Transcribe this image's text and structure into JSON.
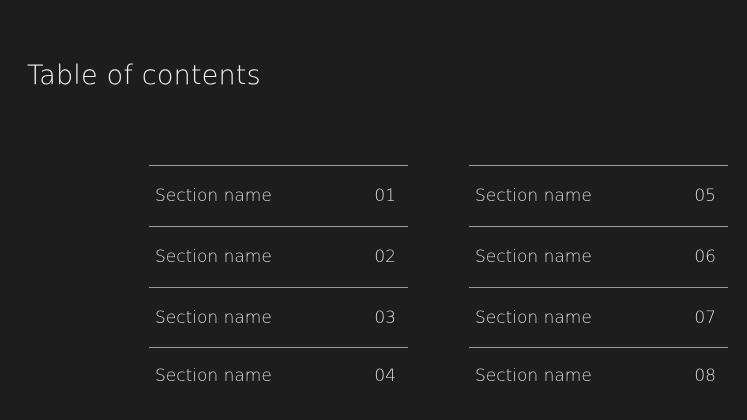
{
  "page": {
    "title": "Table of contents"
  },
  "toc": {
    "left": [
      {
        "label": "Section name",
        "number": "01"
      },
      {
        "label": "Section name",
        "number": "02"
      },
      {
        "label": "Section name",
        "number": "03"
      },
      {
        "label": "Section name",
        "number": "04"
      }
    ],
    "right": [
      {
        "label": "Section name",
        "number": "05"
      },
      {
        "label": "Section name",
        "number": "06"
      },
      {
        "label": "Section name",
        "number": "07"
      },
      {
        "label": "Section name",
        "number": "08"
      }
    ]
  }
}
